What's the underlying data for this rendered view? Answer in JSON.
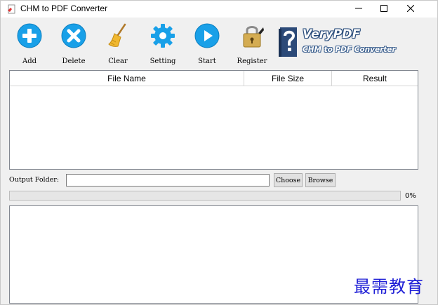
{
  "window": {
    "title": "CHM to PDF Converter",
    "controls": {
      "minimize": "minimize-icon",
      "maximize": "maximize-icon",
      "close": "close-icon"
    }
  },
  "toolbar": {
    "items": [
      {
        "label": "Add",
        "icon": "add-icon",
        "color": "#1ea0e6"
      },
      {
        "label": "Delete",
        "icon": "delete-icon",
        "color": "#1ea0e6"
      },
      {
        "label": "Clear",
        "icon": "broom-icon",
        "color": "#e0a020"
      },
      {
        "label": "Setting",
        "icon": "gear-icon",
        "color": "#1ea0e6"
      },
      {
        "label": "Start",
        "icon": "play-icon",
        "color": "#1ea0e6"
      },
      {
        "label": "Register",
        "icon": "padlock-icon",
        "color": "#c9a24a"
      }
    ]
  },
  "brand": {
    "name": "VeryPDF",
    "product": "CHM to PDF Converter"
  },
  "table": {
    "columns": [
      "File Name",
      "File Size",
      "Result"
    ],
    "rows": []
  },
  "output": {
    "label": "Output Folder:",
    "value": "",
    "choose_label": "Choose",
    "browse_label": "Browse"
  },
  "progress": {
    "value": 0,
    "text": "0%"
  },
  "watermark": "最需教育"
}
